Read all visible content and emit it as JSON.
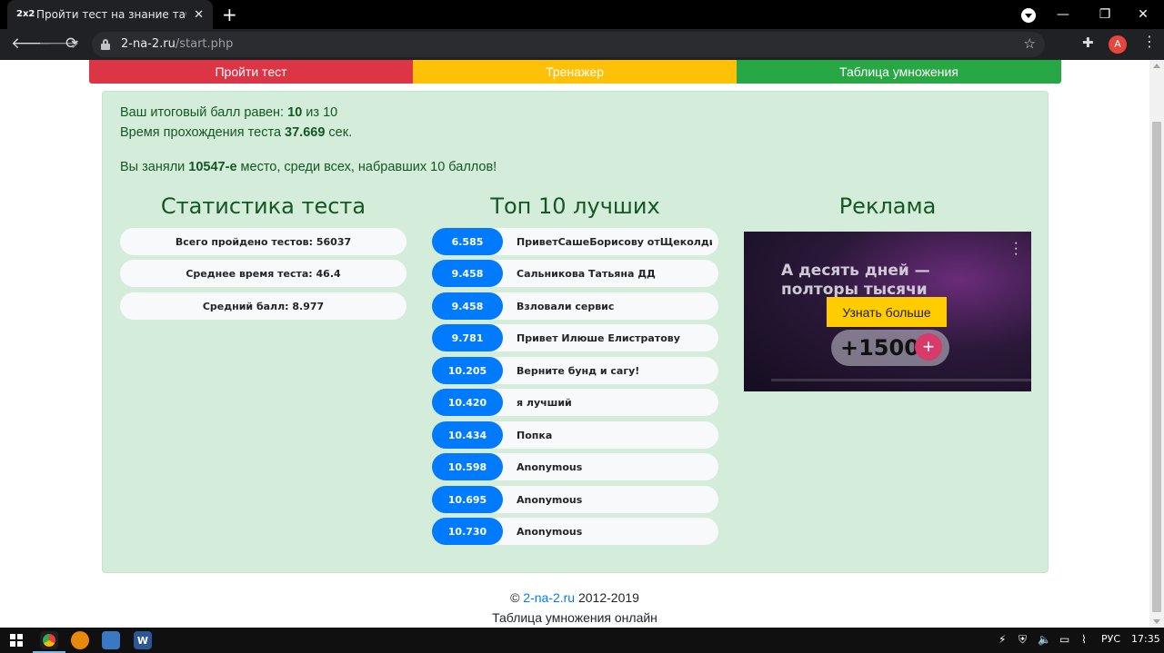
{
  "browser": {
    "tab_favicon": "2x2",
    "tab_title": "Пройти тест на знание таблицы умножения",
    "tab_close": "✕",
    "new_tab": "+",
    "url_domain": "2-na-2.ru",
    "url_path": "/start.php",
    "profile_initial": "A",
    "minimize": "—",
    "maximize": "❐",
    "close": "✕"
  },
  "nav": {
    "test": "Пройти тест",
    "trainer": "Тренажер",
    "table": "Таблица умножения"
  },
  "result": {
    "score_prefix": "Ваш итоговый балл равен: ",
    "score": "10",
    "score_suffix": " из 10",
    "time_prefix": "Время прохождения теста ",
    "time": "37.669",
    "time_suffix": " сек.",
    "place_prefix": "Вы заняли ",
    "place": "10547-е",
    "place_suffix": " место, среди всех, набравших 10 баллов!"
  },
  "stats": {
    "title": "Статистика теста",
    "items": [
      "Всего пройдено тестов: 56037",
      "Среднее время теста: 46.4",
      "Средний балл: 8.977"
    ]
  },
  "top": {
    "title": "Топ 10 лучших",
    "rows": [
      {
        "score": "6.585",
        "name": "ПриветСашеБорисову отЩеколдина"
      },
      {
        "score": "9.458",
        "name": "Сальникова Татьяна ДД"
      },
      {
        "score": "9.458",
        "name": "Взловали сервис"
      },
      {
        "score": "9.781",
        "name": "Привет Илюше Елистратову"
      },
      {
        "score": "10.205",
        "name": "Верните бунд и сагу!"
      },
      {
        "score": "10.420",
        "name": "я лучший"
      },
      {
        "score": "10.434",
        "name": "Попка"
      },
      {
        "score": "10.598",
        "name": "Anonymous"
      },
      {
        "score": "10.695",
        "name": "Anonymous"
      },
      {
        "score": "10.730",
        "name": "Anonymous"
      }
    ]
  },
  "ad": {
    "title": "Реклама",
    "headline_1": "А десять дней —",
    "headline_2": "полторы тысячи",
    "cta": "Узнать больше",
    "amount": "+1500",
    "plus": "+"
  },
  "footer": {
    "copy": "© ",
    "site": "2-na-2.ru",
    "years": " 2012-2019",
    "tagline": "Таблица умножения онлайн"
  },
  "taskbar": {
    "lang": "РУС",
    "time": "17:35"
  }
}
